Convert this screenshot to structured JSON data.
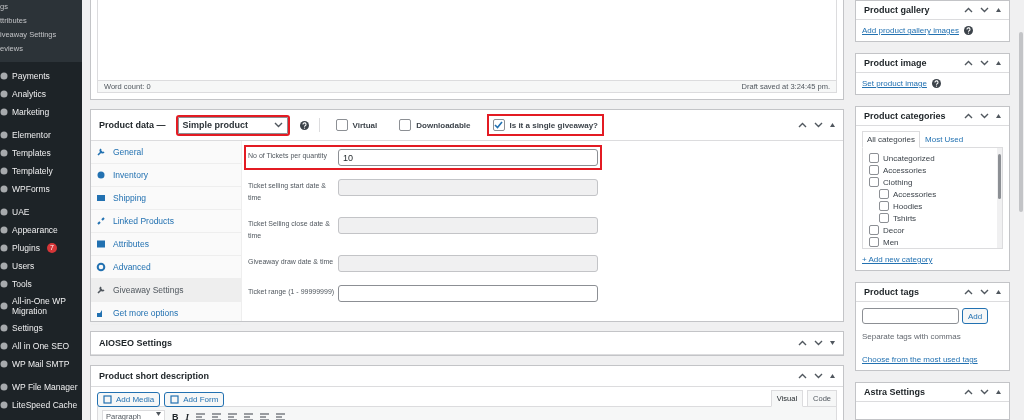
{
  "admin_menu": {
    "submenu": [
      {
        "label": "gs"
      },
      {
        "label": "ttributes"
      },
      {
        "label": "iveaway Settings"
      },
      {
        "label": "eviews"
      }
    ],
    "groups": [
      [
        {
          "label": "Payments"
        },
        {
          "label": "Analytics"
        },
        {
          "label": "Marketing"
        }
      ],
      [
        {
          "label": "Elementor"
        },
        {
          "label": "Templates"
        },
        {
          "label": "Templately"
        },
        {
          "label": "WPForms"
        }
      ],
      [
        {
          "label": "UAE"
        },
        {
          "label": "Appearance"
        },
        {
          "label": "Plugins",
          "badge": "7"
        },
        {
          "label": "Users"
        },
        {
          "label": "Tools"
        },
        {
          "label": "All-in-One WP Migration"
        },
        {
          "label": "Settings"
        },
        {
          "label": "All in One SEO"
        },
        {
          "label": "WP Mail SMTP"
        }
      ],
      [
        {
          "label": "WP File Manager"
        },
        {
          "label": "LiteSpeed Cache"
        }
      ]
    ]
  },
  "editor": {
    "word_count": "Word count: 0",
    "draft_status": "Draft saved at 3:24:45 pm."
  },
  "product_data": {
    "title": "Product data —",
    "product_type": {
      "value": "Simple product",
      "highlighted": true
    },
    "options": [
      {
        "label": "Virtual",
        "checked": false,
        "highlighted": false
      },
      {
        "label": "Downloadable",
        "checked": false,
        "highlighted": false
      },
      {
        "label": "Is it a single giveaway?",
        "checked": true,
        "highlighted": true
      }
    ],
    "tabs": [
      {
        "label": "General",
        "selected": false
      },
      {
        "label": "Inventory",
        "selected": false
      },
      {
        "label": "Shipping",
        "selected": false
      },
      {
        "label": "Linked Products",
        "selected": false
      },
      {
        "label": "Attributes",
        "selected": false
      },
      {
        "label": "Advanced",
        "selected": false
      },
      {
        "label": "Giveaway Settings",
        "selected": true
      },
      {
        "label": "Get more options",
        "selected": false
      }
    ],
    "fields": [
      {
        "label": "No of Tickets per quantity",
        "value": "10",
        "disabled": false,
        "highlighted": true
      },
      {
        "label": "Ticket selling start date & time",
        "disabled": true,
        "highlighted": false
      },
      {
        "label": "Ticket Selling close date & time",
        "disabled": true,
        "highlighted": false
      },
      {
        "label": "Giveaway draw date & time",
        "disabled": true,
        "highlighted": false
      },
      {
        "label": "Ticket range (1 - 99999999)",
        "disabled": false,
        "highlighted": false
      }
    ]
  },
  "aioseo": {
    "title": "AIOSEO Settings",
    "expanded": false
  },
  "short_description": {
    "title": "Product short description",
    "buttons": [
      "Add Media",
      "Add Form"
    ],
    "editor_tabs": [
      {
        "label": "Visual",
        "selected": true
      },
      {
        "label": "Code",
        "selected": false
      }
    ],
    "format": "Paragraph",
    "toolbar_letters": [
      "B",
      "I"
    ]
  },
  "product_gallery": {
    "title": "Product gallery",
    "link": "Add product gallery images"
  },
  "product_image": {
    "title": "Product image",
    "link": "Set product image"
  },
  "product_categories": {
    "title": "Product categories",
    "tabs": [
      {
        "label": "All categories",
        "selected": true
      },
      {
        "label": "Most Used",
        "selected": false
      }
    ],
    "items": [
      {
        "label": "Uncategorized",
        "checked": false
      },
      {
        "label": "Accessories",
        "checked": false
      },
      {
        "label": "Clothing",
        "checked": false,
        "children": [
          {
            "label": "Accessories",
            "checked": false
          },
          {
            "label": "Hoodies",
            "checked": false
          },
          {
            "label": "Tshirts",
            "checked": false
          }
        ]
      },
      {
        "label": "Decor",
        "checked": false
      },
      {
        "label": "Men",
        "checked": false
      }
    ],
    "add_link": "+ Add new category"
  },
  "product_tags": {
    "title": "Product tags",
    "button": "Add",
    "hint": "Separate tags with commas",
    "link": "Choose from the most used tags"
  },
  "astra": {
    "title": "Astra Settings"
  }
}
